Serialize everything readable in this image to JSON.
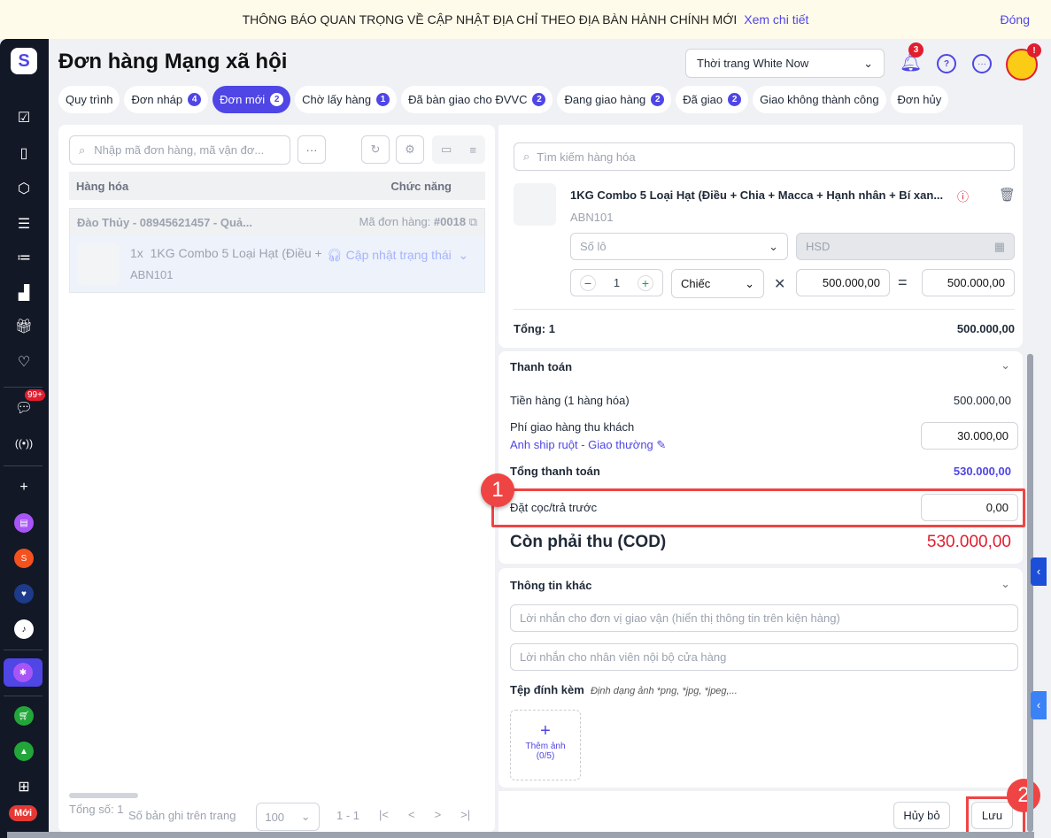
{
  "banner": {
    "text": "THÔNG BÁO QUAN TRỌNG VỀ CẬP NHẬT ĐỊA CHỈ THEO ĐỊA BÀN HÀNH CHÍNH MỚI",
    "link": "Xem chi tiết",
    "close": "Đóng"
  },
  "sidebar": {
    "chat_badge": "99+",
    "new_badge": "Mới"
  },
  "header": {
    "title": "Đơn hàng Mạng xã hội",
    "shop": "Thời trang White Now",
    "notif_count": "3",
    "avatar_badge": "!"
  },
  "tabs": [
    {
      "label": "Quy trình",
      "count": null
    },
    {
      "label": "Đơn nháp",
      "count": "4"
    },
    {
      "label": "Đơn mới",
      "count": "2"
    },
    {
      "label": "Chờ lấy hàng",
      "count": "1"
    },
    {
      "label": "Đã bàn giao cho ĐVVC",
      "count": "2"
    },
    {
      "label": "Đang giao hàng",
      "count": "2"
    },
    {
      "label": "Đã giao",
      "count": "2"
    },
    {
      "label": "Giao không thành công",
      "count": null
    },
    {
      "label": "Đơn hủy",
      "count": null
    }
  ],
  "left": {
    "search_placeholder": "Nhập mã đơn hàng, mã vận đơ...",
    "col_goods": "Hàng hóa",
    "col_func": "Chức năng",
    "order": {
      "customer": "Đào Thủy - 08945621457 - Quả...",
      "code_label": "Mã đơn hàng:",
      "code": "#0018",
      "qty": "1x",
      "product": "1KG Combo 5 Loại Hạt (Điều +",
      "sku": "ABN101",
      "status_action": "Cập nhật trạng thái"
    },
    "footer": {
      "total_label": "Tổng số:",
      "total": "1",
      "per_page_label": "Số bản ghi trên trang",
      "per_page": "100",
      "range": "1 - 1"
    }
  },
  "goods": {
    "section_title": "Hàng hóa",
    "search_placeholder": "Tìm kiếm hàng hóa",
    "product": "1KG Combo 5 Loại Hạt (Điều + Chia + Macca + Hạnh nhân + Bí xan...",
    "sku": "ABN101",
    "lot_placeholder": "Số lô",
    "hsd_placeholder": "HSD",
    "qty": "1",
    "unit": "Chiếc",
    "price": "500.000,00",
    "line_total": "500.000,00",
    "total_label": "Tổng: 1",
    "total": "500.000,00"
  },
  "payment": {
    "title": "Thanh toán",
    "subtotal_label": "Tiền hàng (1 hàng hóa)",
    "subtotal": "500.000,00",
    "ship_label": "Phí giao hàng thu khách",
    "carrier": "Anh ship ruột",
    "sep": " - ",
    "service": "Giao thường",
    "ship_fee": "30.000,00",
    "grand_label": "Tổng thanh toán",
    "grand": "530.000,00",
    "deposit_label": "Đặt cọc/trả trước",
    "deposit": "0,00",
    "cod_label": "Còn phải thu (COD)",
    "cod": "530.000,00"
  },
  "other": {
    "title": "Thông tin khác",
    "carrier_note_placeholder": "Lời nhắn cho đơn vị giao vận (hiển thị thông tin trên kiện hàng)",
    "internal_note_placeholder": "Lời nhắn cho nhân viên nội bộ cửa hàng",
    "attach_label": "Tệp đính kèm",
    "attach_hint": "Định dạng ảnh *png, *jpg, *jpeg,...",
    "add_image": "Thêm ảnh",
    "add_image_count": "(0/5)"
  },
  "actions": {
    "cancel": "Hủy bỏ",
    "save": "Lưu"
  },
  "annotations": {
    "step1": "1",
    "step2": "2"
  },
  "colors": {
    "accent": "#4f46e5",
    "danger": "#e11d2e",
    "sidebar": "#121826"
  }
}
